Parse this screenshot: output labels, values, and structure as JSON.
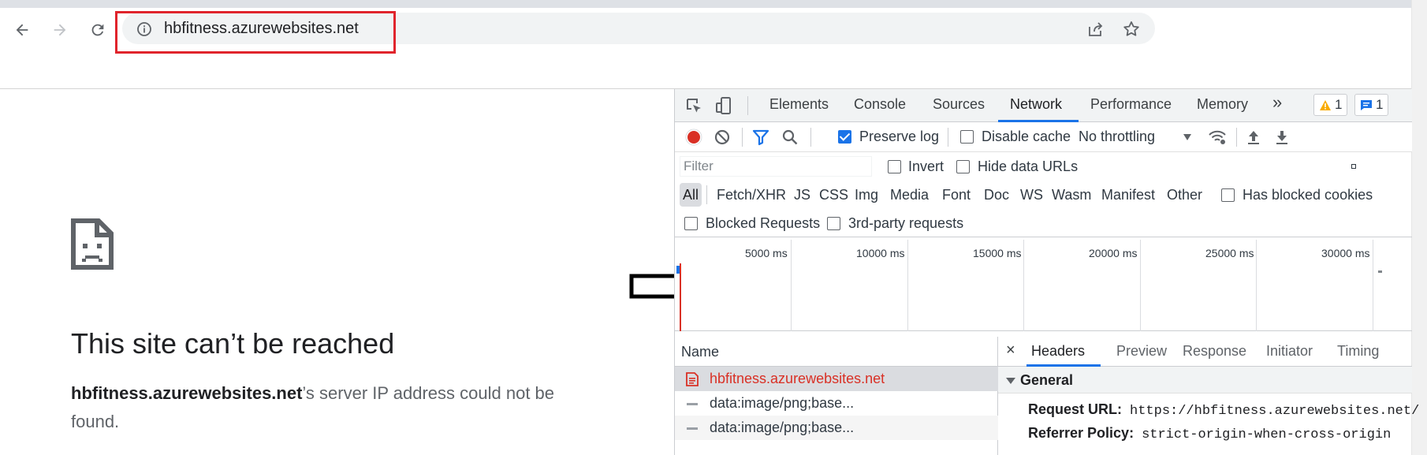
{
  "browser": {
    "url": "hbfitness.azurewebsites.net",
    "icons": {
      "back": "arrow-left-icon",
      "forward": "arrow-right-icon",
      "reload": "reload-icon",
      "site_info": "info-icon",
      "share": "share-icon",
      "bookmark": "star-icon"
    },
    "highlight_color": "#e0242c"
  },
  "error_page": {
    "title": "This site can’t be reached",
    "host": "hbfitness.azurewebsites.net",
    "message_rest": "’s server IP address could not be found.",
    "icon": "sad-page-icon"
  },
  "annotation": {
    "icon": "arrow-right-outline-icon"
  },
  "devtools": {
    "tabs": [
      "Elements",
      "Console",
      "Sources",
      "Network",
      "Performance",
      "Memory"
    ],
    "active_tab": "Network",
    "more_tabs_label": "»",
    "warnings_count": "1",
    "messages_count": "1",
    "controls": {
      "preserve_log": "Preserve log",
      "preserve_log_checked": true,
      "disable_cache": "Disable cache",
      "throttling": "No throttling"
    },
    "filter": {
      "placeholder": "Filter",
      "invert": "Invert",
      "hide_data_urls": "Hide data URLs"
    },
    "types": [
      "All",
      "Fetch/XHR",
      "JS",
      "CSS",
      "Img",
      "Media",
      "Font",
      "Doc",
      "WS",
      "Wasm",
      "Manifest",
      "Other"
    ],
    "has_blocked_cookies": "Has blocked cookies",
    "blocked_requests": "Blocked Requests",
    "third_party": "3rd-party requests",
    "timeline_ticks": [
      "5000 ms",
      "10000 ms",
      "15000 ms",
      "20000 ms",
      "25000 ms",
      "30000 ms"
    ],
    "name_column": "Name",
    "requests": [
      "hbfitness.azurewebsites.net",
      "data:image/png;base...",
      "data:image/png;base..."
    ],
    "detail_tabs": [
      "Headers",
      "Preview",
      "Response",
      "Initiator",
      "Timing"
    ],
    "detail_close": "×",
    "active_detail_tab": "Headers",
    "general": {
      "title": "General",
      "request_url_label": "Request URL:",
      "request_url": "https://hbfitness.azurewebsites.net/",
      "referrer_policy_label": "Referrer Policy:",
      "referrer_policy": "strict-origin-when-cross-origin"
    },
    "accent_color": "#1a73e8",
    "error_color": "#d93025"
  }
}
